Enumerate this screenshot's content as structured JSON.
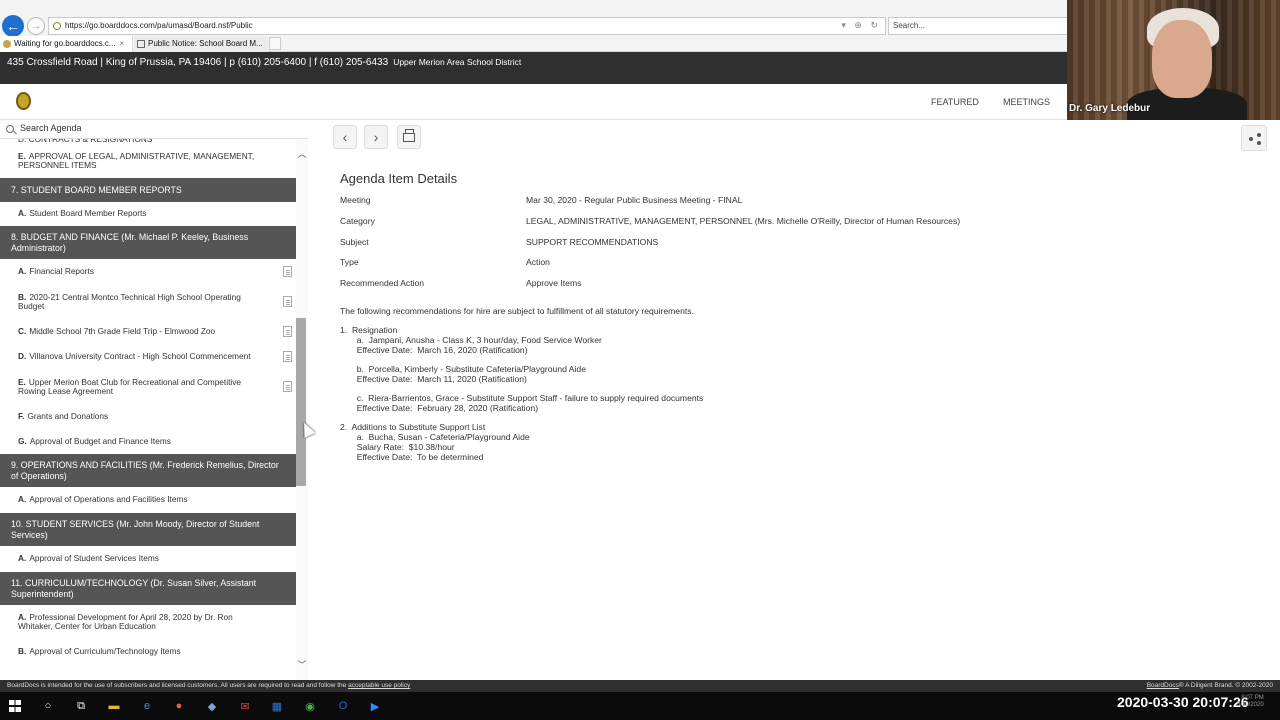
{
  "browser": {
    "url": "https://go.boarddocs.com/pa/umasd/Board.nsf/Public",
    "search_placeholder": "Search...",
    "tabs": [
      {
        "label": "Waiting for go.boarddocs.c...",
        "close": "×"
      },
      {
        "label": "Public Notice: School Board M..."
      }
    ]
  },
  "header": {
    "contact": "435 Crossfield Road | King of Prussia, PA 19406 | p (610) 205-6400 | f (610) 205-6433",
    "district": "Upper Merion Area School District",
    "nav": [
      "FEATURED",
      "MEETINGS"
    ]
  },
  "webcam": {
    "name": "Dr. Gary Ledebur"
  },
  "sidebar": {
    "search_placeholder": "Search Agenda",
    "cut_item": "D. CONTRACTS & RESIGNATIONS",
    "rows": [
      {
        "kind": "item",
        "letter": "E.",
        "text": "APPROVAL OF LEGAL, ADMINISTRATIVE, MANAGEMENT, PERSONNEL ITEMS",
        "h": 34,
        "doc": false
      },
      {
        "kind": "section",
        "text": "7. STUDENT BOARD MEMBER REPORTS",
        "h": 24
      },
      {
        "kind": "item",
        "letter": "A.",
        "text": "Student Board Member Reports",
        "h": 24,
        "doc": false
      },
      {
        "kind": "section",
        "text": "8. BUDGET AND FINANCE (Mr. Michael P. Keeley, Business Administrator)",
        "h": 33
      },
      {
        "kind": "item",
        "letter": "A.",
        "text": "Financial Reports",
        "h": 26,
        "doc": true
      },
      {
        "kind": "item",
        "letter": "B.",
        "text": "2020-21 Central Montco Technical High School Operating Budget",
        "h": 34,
        "doc": true
      },
      {
        "kind": "item",
        "letter": "C.",
        "text": "Middle School 7th Grade Field Trip - Elmwood Zoo",
        "h": 25,
        "doc": true
      },
      {
        "kind": "item",
        "letter": "D.",
        "text": "Villanova University Contract - High School Commencement",
        "h": 26,
        "doc": true
      },
      {
        "kind": "item",
        "letter": "E.",
        "text": "Upper Merion Boat Club for Recreational and Competitive Rowing Lease Agreement",
        "h": 34,
        "doc": true
      },
      {
        "kind": "item",
        "letter": "F.",
        "text": "Grants and Donations",
        "h": 25,
        "doc": false
      },
      {
        "kind": "item",
        "letter": "G.",
        "text": "Approval of Budget and Finance Items",
        "h": 25,
        "doc": false
      },
      {
        "kind": "section",
        "text": "9. OPERATIONS AND FACILITIES (Mr. Frederick Remelius, Director of Operations)",
        "h": 33
      },
      {
        "kind": "item",
        "letter": "A.",
        "text": "Approval of Operations and Facilities Items",
        "h": 26,
        "doc": false
      },
      {
        "kind": "section",
        "text": "10. STUDENT SERVICES (Mr. John Moody, Director of Student Services)",
        "h": 33
      },
      {
        "kind": "item",
        "letter": "A.",
        "text": "Approval of Student Services Items",
        "h": 26,
        "doc": false
      },
      {
        "kind": "section",
        "text": "11. CURRICULUM/TECHNOLOGY (Dr. Susan Silver, Assistant Superintendent)",
        "h": 33
      },
      {
        "kind": "item",
        "letter": "A.",
        "text": "Professional Development for April 28, 2020 by Dr. Ron Whitaker, Center for Urban Education",
        "h": 34,
        "doc": false
      },
      {
        "kind": "item",
        "letter": "B.",
        "text": "Approval of Curriculum/Technology Items",
        "h": 26,
        "doc": false
      }
    ]
  },
  "detail": {
    "title": "Agenda Item Details",
    "fields": [
      {
        "label": "Meeting",
        "value": "Mar 30, 2020 - Regular Public Business Meeting - FINAL"
      },
      {
        "label": "Category",
        "value": "LEGAL, ADMINISTRATIVE, MANAGEMENT, PERSONNEL (Mrs. Michelle O'Reilly, Director of Human Resources)"
      },
      {
        "label": "Subject",
        "value": "SUPPORT RECOMMENDATIONS"
      },
      {
        "label": "Type",
        "value": "Action"
      },
      {
        "label": "Recommended Action",
        "value": "Approve Items"
      }
    ],
    "body": "The following recommendations for hire are subject to fulfillment of all statutory requirements.\n\n1.  Resignation\n       a.  Jampani, Anusha - Class K, 3 hour/day, Food Service Worker\n       Effective Date:  March 16, 2020 (Ratification)\n\n       b.  Porcella, Kimberly - Substitute Cafeteria/Playground Aide\n       Effective Date:  March 11, 2020 (Ratification)\n\n       c.  Riera-Barrientos, Grace - Substitute Support Staff - failure to supply required documents\n       Effective Date:  February 28, 2020 (Ratification)\n\n2.  Additions to Substitute Support List\n       a.  Bucha, Susan - Cafeteria/Playground Aide\n       Salary Rate:  $10.38/hour\n       Effective Date:  To be determined"
  },
  "footer": {
    "left": "BoardDocs is intended for the use of subscribers and licensed customers. All users are required to read and follow the",
    "link": "acceptable use policy",
    "brand": "BoardDocs",
    "right": "® A Diligent Brand. © 2002-2020"
  },
  "taskbar": {
    "clock": "2020-03-30  20:07:26",
    "mini": "8:07 PM\n3/30/2020",
    "apps": [
      "search-icon",
      "task-view-icon",
      "file-explorer-icon",
      "ie-icon",
      "firefox-icon",
      "app-icon",
      "mail-icon",
      "calendar-icon",
      "chrome-icon",
      "outlook-icon",
      "zoom-icon"
    ]
  },
  "colors": {
    "header_bg": "#2f2f2f",
    "section_bg": "#555555",
    "accent_blue": "#1e6fd1"
  }
}
